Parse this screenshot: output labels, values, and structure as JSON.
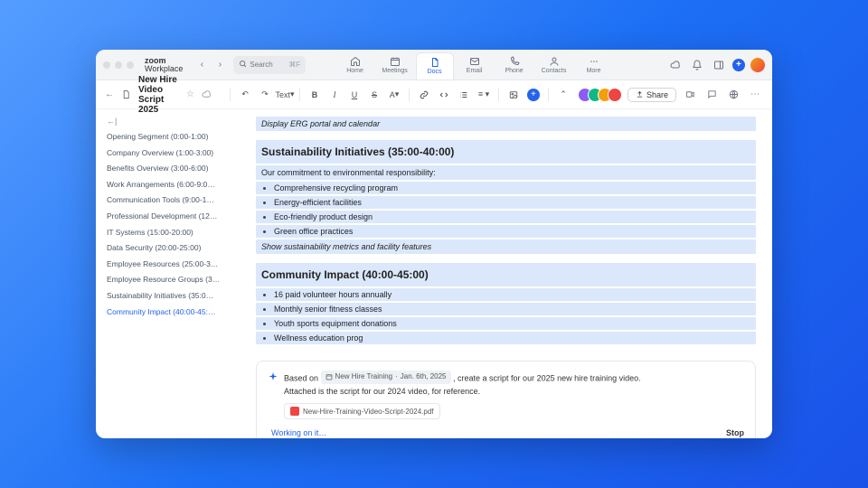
{
  "brand": {
    "line1": "zoom",
    "line2": "Workplace"
  },
  "search": {
    "placeholder": "Search",
    "shortcut": "⌘F"
  },
  "nav_tabs": {
    "home": "Home",
    "meetings": "Meetings",
    "docs": "Docs",
    "email": "Email",
    "phone": "Phone",
    "contacts": "Contacts",
    "more": "More"
  },
  "doc": {
    "title": "New Hire Video Script 2025",
    "toolbar": {
      "text_menu": "Text",
      "bold": "B",
      "italic": "I",
      "underline": "U",
      "strike": "S",
      "letter_a": "A"
    },
    "share_label": "Share"
  },
  "outline": {
    "items": [
      "Opening Segment (0:00-1:00)",
      "Company Overview (1:00-3:00)",
      "Benefits Overview (3:00-6:00)",
      "Work Arrangements (6:00-9:0…",
      "Communication Tools (9:00-1…",
      "Professional Development (12…",
      "IT Systems (15:00-20:00)",
      "Data Security (20:00-25:00)",
      "Employee Resources (25:00-3…",
      "Employee Resource Groups (3…",
      "Sustainability Initiatives (35:0…",
      "Community Impact (40:00-45:…"
    ],
    "active_index": 11
  },
  "body": {
    "erg_note": "Display ERG portal and calendar",
    "sustainability": {
      "heading": "Sustainability Initiatives (35:00-40:00)",
      "intro": "Our commitment to environmental responsibility:",
      "bullets": [
        "Comprehensive recycling program",
        "Energy-efficient facilities",
        "Eco-friendly product design",
        "Green office practices"
      ],
      "note": "Show sustainability metrics and facility features"
    },
    "community": {
      "heading": "Community Impact (40:00-45:00)",
      "bullets": [
        "16 paid volunteer hours annually",
        "Monthly senior fitness classes",
        "Youth sports equipment donations",
        "Wellness education prog"
      ]
    }
  },
  "prompt": {
    "based_on": "Based on",
    "chip_title": "New Hire Training",
    "chip_date": "Jan. 6th, 2025",
    "sentence_tail": ", create a script for our 2025 new hire training video.",
    "line2": "Attached is the script for our 2024 video, for reference.",
    "attachment": "New-Hire-Training-Video-Script-2024.pdf",
    "working": "Working on it…",
    "stop": "Stop"
  }
}
